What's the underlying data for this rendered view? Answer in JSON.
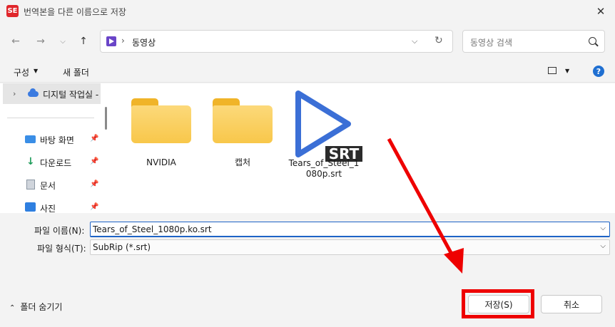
{
  "window": {
    "title": "번역본을 다른 이름으로 저장",
    "app_icon_text": "SE",
    "close_label": "✕"
  },
  "nav": {
    "address_path": "동영상",
    "search_placeholder": "동영상 검색"
  },
  "toolbar": {
    "organize_label": "구성",
    "new_folder_label": "새 폴더",
    "help_label": "?"
  },
  "sidebar": {
    "top_item": "디지털 작업실 -",
    "items": [
      {
        "label": "바탕 화면",
        "icon": "desktop-icon"
      },
      {
        "label": "다운로드",
        "icon": "download-icon"
      },
      {
        "label": "문서",
        "icon": "document-icon"
      },
      {
        "label": "사진",
        "icon": "pictures-icon"
      }
    ]
  },
  "files": [
    {
      "name": "NVIDIA",
      "type": "folder"
    },
    {
      "name": "캡처",
      "type": "folder"
    },
    {
      "name": "Tears_of_Steel_1\n080p.srt",
      "type": "srt",
      "badge": "SRT"
    }
  ],
  "form": {
    "filename_label": "파일 이름(N):",
    "filename_value": "Tears_of_Steel_1080p.ko.srt",
    "filetype_label": "파일 형식(T):",
    "filetype_value": "SubRip (*.srt)"
  },
  "footer": {
    "hide_folders_label": "폴더 숨기기",
    "save_label": "저장(S)",
    "cancel_label": "취소"
  },
  "colors": {
    "annotation": "#ee0000",
    "accent": "#1e63c6",
    "folder": "#f8c74a",
    "srt_play": "#3b6fd6"
  }
}
